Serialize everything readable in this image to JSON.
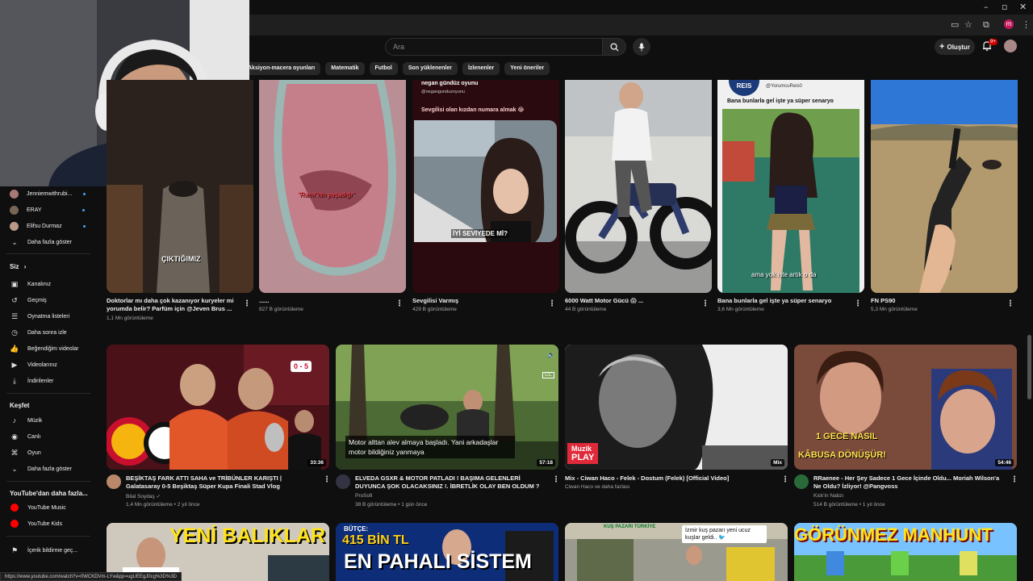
{
  "browser": {
    "status_url": "https://www.youtube.com/watch?v=0WCKDVm-LYw&pp=ugUEEgJ0cg%3D%3D",
    "profile_initial": "m"
  },
  "header": {
    "search_placeholder": "Ara",
    "create_label": "Oluştur",
    "notification_count": "9+"
  },
  "chips": [
    "Aksiyon-macera oyunları",
    "Matematik",
    "Futbol",
    "Son yüklenenler",
    "İzlenenler",
    "Yeni öneriler"
  ],
  "sidebar": {
    "subscriptions": [
      {
        "label": "Jenniemwithrubi...",
        "live": true
      },
      {
        "label": "ERAY",
        "live": true
      },
      {
        "label": "Elifsu Durmaz",
        "live": true
      }
    ],
    "show_more_subs": "Daha fazla göster",
    "you_heading": "Siz",
    "you_chevron": "›",
    "you_items": [
      "Kanalınız",
      "Geçmiş",
      "Oynatma listeleri",
      "Daha sonra izle",
      "Beğendiğim videolar",
      "Videolarınız",
      "İndirilenler"
    ],
    "explore_heading": "Keşfet",
    "explore_items": [
      "Müzik",
      "Canlı",
      "Oyun"
    ],
    "show_more_explore": "Daha fazla göster",
    "more_heading": "YouTube'dan daha fazla...",
    "more_items": [
      "YouTube Music",
      "YouTube Kids"
    ],
    "report": "İçerik bildirme geç..."
  },
  "shorts": [
    {
      "title": "Doktorlar mı daha çok kazanıyor kuryeler mi yorumda belir? Parfüm için @Jeven Brus ...",
      "views": "1,1 Mn görüntüleme",
      "overlay": "ÇIKTIĞIMIZ"
    },
    {
      "title": "......",
      "views": "827 B görüntüleme",
      "overlay": "\"Rami\"nin yaşadığı\""
    },
    {
      "title": "Sevgilisi Varmış",
      "views": "429 B görüntüleme",
      "overlay": "İYİ SEVİYEDE Mİ?",
      "top_name": "negan gündüz oyunu",
      "top_handle": "@negangunduzoyunu",
      "top_caption": "Sevgilisi olan kızdan numara almak 😂"
    },
    {
      "title": "6000 Watt Motor Gücü 😱 ...",
      "views": "44 B görüntüleme"
    },
    {
      "title": "Bana bunlarla gel işte ya süper senaryo",
      "views": "3,6 Mn görüntüleme",
      "overlay": "ama yok işte artık o da",
      "top_handle": "@YorumcuReis0",
      "top_caption": "Bana bunlarla gel işte ya süper senaryo",
      "logo": "REIS"
    },
    {
      "title": "FN PS90",
      "views": "5,3 Mn görüntüleme"
    }
  ],
  "videos_row1": [
    {
      "title": "BEŞİKTAŞ FARK ATTI SAHA ve TRİBÜNLER KARIŞTI | Galatasaray 0-5 Beşiktaş Süper Kupa Finali Stad Vlog",
      "channel": "Bilal Soydaş",
      "verified": "✓",
      "meta": "1,4 Mn görüntüleme • 2 yıl önce",
      "duration": "33:36",
      "score": "0 - 5"
    },
    {
      "title": "ELVEDA GSXR & MOTOR PATLADI ! BAŞIMA GELENLERİ DUYUNCA ŞOK OLACAKSINIZ !. İBRETLİK OLAY BEN OLDUM ?",
      "channel": "ProSofi",
      "meta": "38 B görüntüleme • 1 gün önce",
      "duration": "57:18",
      "caption": "Motor alttan alev almaya başladı. Yani arkadaşlar motor bildiğiniz yanmaya"
    },
    {
      "title": "Mix - Ciwan Haco - Felek - Dostum (Felek) [Official Video]",
      "channel": "Ciwan Haco ve daha fazlası",
      "meta": "",
      "duration": "Mix",
      "logo_a": "Muzik",
      "logo_b": "PLAY"
    },
    {
      "title": "RRaenee - Her Şey Sadece 1 Gece İçinde Oldu... Moriah Wilson'a Ne Oldu? İzliyor! @Pangvoss",
      "channel": "Kick'in Nabzı",
      "meta": "514 B görüntüleme • 1 yıl önce",
      "duration": "54:46",
      "overlay_a": "1 GECE NASIL",
      "overlay_b": "KÂBUSA DÖNÜŞÜR!"
    }
  ],
  "videos_row2": [
    {
      "overlay": "YENİ BALIKLAR"
    },
    {
      "overlay_a": "BÜTÇE:",
      "overlay_b": "415 BİN TL",
      "overlay_c": "EN PAHALI SİSTEM"
    },
    {
      "overlay_a": "KUŞ PAZARI TÜRKİYE",
      "overlay_b": "İzmir kuş pazarı yeni ucuz kuşlar geldi.. 🐦"
    },
    {
      "overlay": "GÖRÜNMEZ MANHUNT"
    }
  ],
  "colors": {
    "bg": "#0f0f0f",
    "accent_red": "#ff0000",
    "live_blue": "#3ea6ff",
    "chip_bg": "#272727"
  }
}
